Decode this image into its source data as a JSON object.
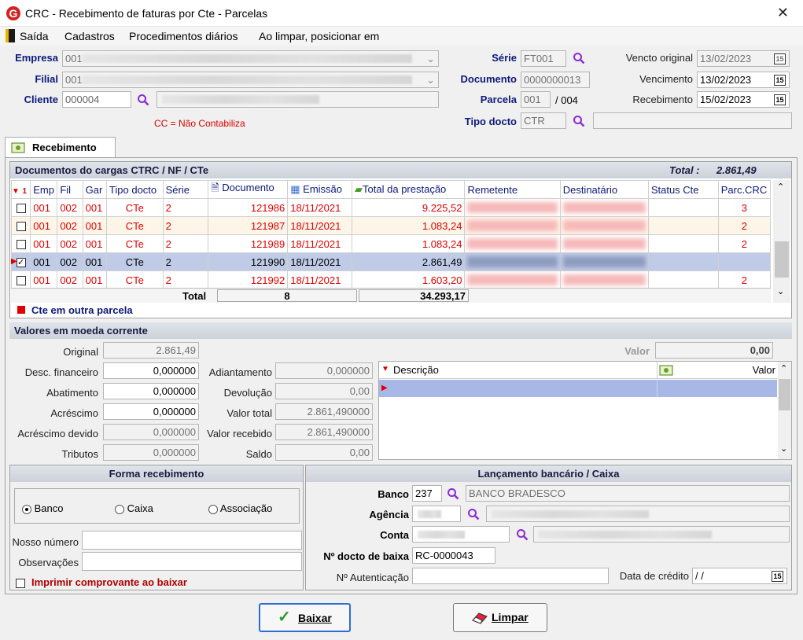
{
  "window": {
    "title": "CRC - Recebimento de faturas por Cte - Parcelas",
    "close": "✕"
  },
  "menu": [
    "Saída",
    "Cadastros",
    "Procedimentos diários",
    "Ao limpar, posicionar em"
  ],
  "header": {
    "empresa_label": "Empresa",
    "empresa_value": "001",
    "filial_label": "Filial",
    "filial_value": "001",
    "cliente_label": "Cliente",
    "cliente_value": "000004",
    "cc_note": "CC = Não Contabiliza",
    "serie_label": "Série",
    "serie_value": "FT001",
    "documento_label": "Documento",
    "documento_value": "0000000013",
    "parcela_label": "Parcela",
    "parcela_value": "001",
    "parcela_total": "/ 004",
    "tipo_label": "Tipo docto",
    "tipo_value": "CTR",
    "vencto_original_label": "Vencto original",
    "vencto_original_value": "13/02/2023",
    "vencimento_label": "Vencimento",
    "vencimento_value": "13/02/2023",
    "recebimento_label": "Recebimento",
    "recebimento_value": "15/02/2023",
    "calendar_glyph": "15"
  },
  "tab": {
    "label": "Recebimento"
  },
  "documents": {
    "title": "Documentos do cargas CTRC / NF / CTe",
    "total_label": "Total :",
    "total_value": "2.861,49",
    "columns": [
      "1",
      "Emp",
      "Fil",
      "Gar",
      "Tipo docto",
      "Série",
      "Documento",
      "Emissão",
      "Total da prestação",
      "Remetente",
      "Destinatário",
      "Status Cte",
      "Parc.CRC"
    ],
    "rows": [
      {
        "emp": "001",
        "fil": "002",
        "gar": "001",
        "tipo": "CTe",
        "serie": "2",
        "doc": "121986",
        "emissao": "18/11/2021",
        "total": "9.225,52",
        "parc": "3"
      },
      {
        "emp": "001",
        "fil": "002",
        "gar": "001",
        "tipo": "CTe",
        "serie": "2",
        "doc": "121987",
        "emissao": "18/11/2021",
        "total": "1.083,24",
        "parc": "2"
      },
      {
        "emp": "001",
        "fil": "002",
        "gar": "001",
        "tipo": "CTe",
        "serie": "2",
        "doc": "121989",
        "emissao": "18/11/2021",
        "total": "1.083,24",
        "parc": "2"
      },
      {
        "emp": "001",
        "fil": "002",
        "gar": "001",
        "tipo": "CTe",
        "serie": "2",
        "doc": "121990",
        "emissao": "18/11/2021",
        "total": "2.861,49",
        "parc": ""
      },
      {
        "emp": "001",
        "fil": "002",
        "gar": "001",
        "tipo": "CTe",
        "serie": "2",
        "doc": "121992",
        "emissao": "18/11/2021",
        "total": "1.603,20",
        "parc": "2"
      }
    ],
    "footer_total_label": "Total",
    "footer_count": "8",
    "footer_sum": "34.293,17",
    "legend": "Cte em outra parcela"
  },
  "valores": {
    "title": "Valores em moeda corrente",
    "original_label": "Original",
    "original_value": "2.861,49",
    "desc_label": "Desc. financeiro",
    "desc_value": "0,000000",
    "abat_label": "Abatimento",
    "abat_value": "0,000000",
    "acresc_label": "Acréscimo",
    "acresc_value": "0,000000",
    "acresc_dev_label": "Acréscimo devido",
    "acresc_dev_value": "0,000000",
    "tributos_label": "Tributos",
    "tributos_value": "0,000000",
    "adiant_label": "Adiantamento",
    "adiant_value": "0,000000",
    "devol_label": "Devolução",
    "devol_value": "0,00",
    "vtotal_label": "Valor total",
    "vtotal_value": "2.861,490000",
    "vrecebido_label": "Valor recebido",
    "vrecebido_value": "2.861,490000",
    "saldo_label": "Saldo",
    "saldo_value": "0,00",
    "valor_label": "Valor",
    "valor_value": "0,00",
    "desc_col": "Descrição",
    "valor_col": "Valor"
  },
  "forma": {
    "title": "Forma recebimento",
    "options": [
      "Banco",
      "Caixa",
      "Associação"
    ],
    "nosso_label": "Nosso número",
    "obs_label": "Observações",
    "imprimir_label": "Imprimir comprovante ao baixar"
  },
  "lancamento": {
    "title": "Lançamento bancário / Caixa",
    "banco_label": "Banco",
    "banco_code": "237",
    "banco_name": "BANCO BRADESCO",
    "agencia_label": "Agência",
    "conta_label": "Conta",
    "docto_baixa_label": "Nº docto de baixa",
    "docto_baixa_value": "RC-0000043",
    "autent_label": "Nº Autenticação",
    "data_credito_label": "Data de crédito",
    "data_credito_value": " /  /"
  },
  "buttons": {
    "baixar": "Baixar",
    "limpar": "Limpar"
  },
  "colors": {
    "accent": "#0d1a7a",
    "red": "#e00000",
    "selected_row": "#bfcbe7"
  }
}
